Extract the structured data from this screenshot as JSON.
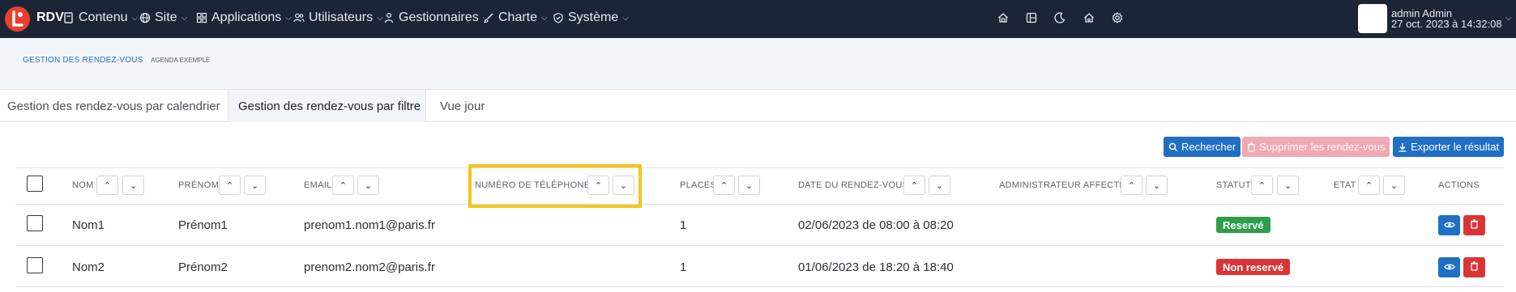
{
  "navbar": {
    "brand": "RDV",
    "menu": [
      {
        "label": "Contenu",
        "icon": "content-icon"
      },
      {
        "label": "Site",
        "icon": "globe-icon"
      },
      {
        "label": "Applications",
        "icon": "grid-icon"
      },
      {
        "label": "Utilisateurs",
        "icon": "users-icon"
      },
      {
        "label": "Gestionnaires",
        "icon": "managers-icon"
      },
      {
        "label": "Charte",
        "icon": "brush-icon"
      },
      {
        "label": "Système",
        "icon": "shield-icon"
      }
    ],
    "right_icons": [
      "home-icon",
      "layout-icon",
      "moon-icon",
      "home-gear-icon",
      "gear-icon"
    ],
    "user": {
      "name": "admin Admin",
      "date": "27 oct. 2023 à 14:32:08"
    }
  },
  "breadcrumb": {
    "title": "GESTION DES RENDEZ-VOUS",
    "subtitle": "AGENDA EXEMPLE"
  },
  "tabs": [
    {
      "label": "Gestion des rendez-vous par calendrier",
      "active": false
    },
    {
      "label": "Gestion des rendez-vous par filtre",
      "active": true
    },
    {
      "label": "Vue jour",
      "active": false
    }
  ],
  "actions": {
    "search": "Rechercher",
    "delete": "Supprimer les rendez-vous",
    "export": "Exporter le résultat"
  },
  "table": {
    "columns": [
      {
        "label": "NOM",
        "sortable": true
      },
      {
        "label": "PRÉNOM",
        "sortable": true
      },
      {
        "label": "EMAIL",
        "sortable": true
      },
      {
        "label": "NUMÉRO DE TÉLÉPHONE",
        "sortable": true
      },
      {
        "label": "PLACES",
        "sortable": true
      },
      {
        "label": "DATE DU RENDEZ-VOUS",
        "sortable": true
      },
      {
        "label": "ADMINISTRATEUR AFFECTÉ",
        "sortable": true
      },
      {
        "label": "STATUT",
        "sortable": true
      },
      {
        "label": "ETAT",
        "sortable": true
      },
      {
        "label": "ACTIONS",
        "sortable": false
      }
    ],
    "rows": [
      {
        "nom": "Nom1",
        "prenom": "Prénom1",
        "email": "prenom1.nom1@paris.fr",
        "telephone": "",
        "places": "1",
        "date": "02/06/2023 de 08:00 à 08:20",
        "admin": "",
        "statut": "Reservé",
        "etat": ""
      },
      {
        "nom": "Nom2",
        "prenom": "Prénom2",
        "email": "prenom2.nom2@paris.fr",
        "telephone": "",
        "places": "1",
        "date": "01/06/2023 de 18:20 à 18:40",
        "admin": "",
        "statut": "Non reservé",
        "etat": ""
      }
    ]
  },
  "colors": {
    "navbar": "#1c2536",
    "primary": "#1f6fc4",
    "danger": "#d93535",
    "success": "#2e9e4a",
    "highlight": "#f5c518"
  },
  "sort_icons": {
    "up": "chevron-up-icon",
    "down": "chevron-down-icon"
  }
}
